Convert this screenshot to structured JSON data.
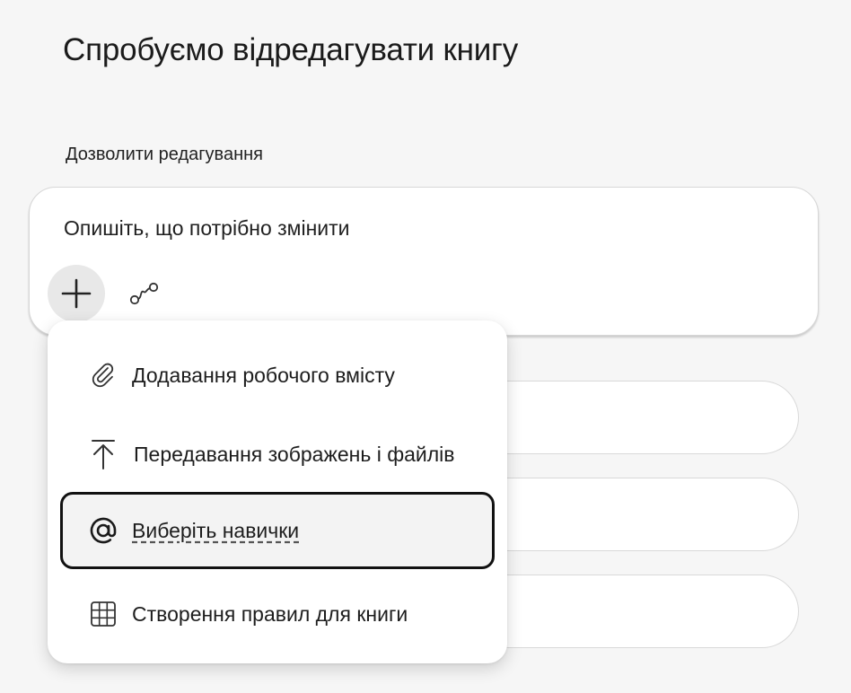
{
  "page": {
    "title": "Спробуємо відредагувати книгу",
    "section_label": "Дозволити редагування"
  },
  "prompt": {
    "placeholder": "Опишіть, що потрібно змінити",
    "add_icon": "plus-icon",
    "link_icon": "connector-icon"
  },
  "menu": {
    "items": [
      {
        "label": "Додавання робочого вмісту",
        "icon": "paperclip-icon"
      },
      {
        "label": "Передавання зображень і файлів",
        "icon": "upload-icon"
      },
      {
        "label": "Виберіть навички",
        "icon": "at-sign-icon",
        "focused": true
      },
      {
        "label": "Створення правил для книги",
        "icon": "grid-icon"
      }
    ]
  }
}
